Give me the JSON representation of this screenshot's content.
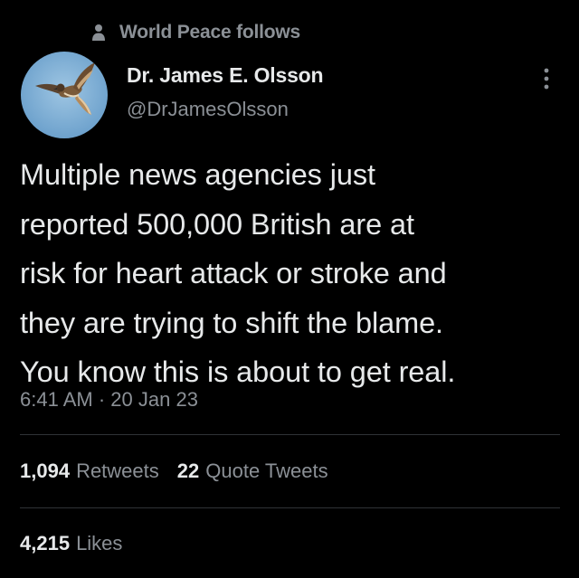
{
  "social_context": {
    "text": "World Peace follows",
    "icon": "person-icon"
  },
  "author": {
    "display_name": "Dr. James E. Olsson",
    "handle": "@DrJamesOlsson",
    "avatar": "hawk-avatar"
  },
  "tweet": {
    "lines": [
      "Multiple news agencies just",
      "reported 500,000 British are at",
      "risk for heart attack or stroke and",
      "they are trying to shift the blame.",
      "You know this is about to get real."
    ],
    "time": "6:41 AM",
    "separator": "·",
    "date": "20 Jan 23"
  },
  "stats": {
    "retweets_count": "1,094",
    "retweets_label": "Retweets",
    "quotes_count": "22",
    "quotes_label": "Quote Tweets",
    "likes_count": "4,215",
    "likes_label": "Likes"
  },
  "colors": {
    "background": "#000000",
    "primary_text": "#e7e9ea",
    "secondary_text": "#8b9096",
    "divider": "#2f3336"
  }
}
